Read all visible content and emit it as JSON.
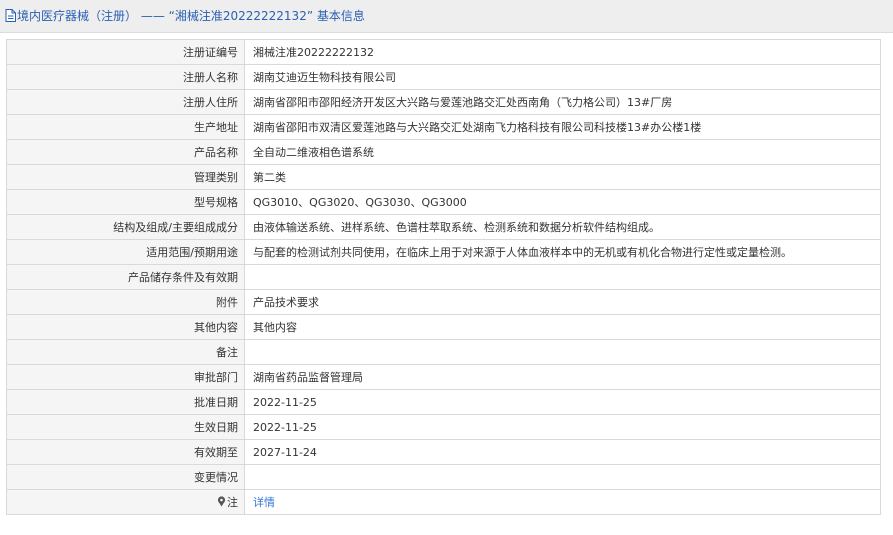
{
  "header": {
    "icon": "document-icon",
    "title": "境内医疗器械（注册） —— “湘械注准20222222132” 基本信息"
  },
  "rows": [
    {
      "label": "注册证编号",
      "value": "湘械注准20222222132"
    },
    {
      "label": "注册人名称",
      "value": "湖南艾迪迈生物科技有限公司"
    },
    {
      "label": "注册人住所",
      "value": "湖南省邵阳市邵阳经济开发区大兴路与爱莲池路交汇处西南角（飞力格公司）13#厂房"
    },
    {
      "label": "生产地址",
      "value": "湖南省邵阳市双清区爱莲池路与大兴路交汇处湖南飞力格科技有限公司科技楼13#办公楼1楼"
    },
    {
      "label": "产品名称",
      "value": "全自动二维液相色谱系统"
    },
    {
      "label": "管理类别",
      "value": "第二类"
    },
    {
      "label": "型号规格",
      "value": "QG3010、QG3020、QG3030、QG3000"
    },
    {
      "label": "结构及组成/主要组成成分",
      "value": "由液体输送系统、进样系统、色谱柱萃取系统、检测系统和数据分析软件结构组成。"
    },
    {
      "label": "适用范围/预期用途",
      "value": "与配套的检测试剂共同使用，在临床上用于对来源于人体血液样本中的无机或有机化合物进行定性或定量检测。"
    },
    {
      "label": "产品储存条件及有效期",
      "value": ""
    },
    {
      "label": "附件",
      "value": "产品技术要求"
    },
    {
      "label": "其他内容",
      "value": "其他内容"
    },
    {
      "label": "备注",
      "value": ""
    },
    {
      "label": "审批部门",
      "value": "湖南省药品监督管理局"
    },
    {
      "label": "批准日期",
      "value": "2022-11-25"
    },
    {
      "label": "生效日期",
      "value": "2022-11-25"
    },
    {
      "label": "有效期至",
      "value": "2027-11-24"
    },
    {
      "label": "变更情况",
      "value": ""
    }
  ],
  "note_row": {
    "icon": "pin-icon",
    "label": "注",
    "link_text": "详情"
  },
  "colors": {
    "title_text": "#2a5fb4",
    "link": "#3476d6",
    "label_bg": "#f5f5f5",
    "border": "#d9d9d9"
  }
}
